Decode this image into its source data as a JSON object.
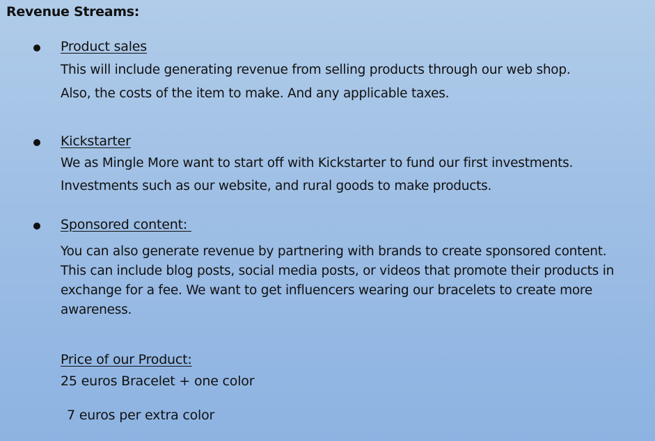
{
  "heading": "Revenue Streams:",
  "items": [
    {
      "title": "Product sales",
      "lines": [
        "This will include generating revenue from selling products through our web shop.",
        "Also, the costs of the item to make. And any applicable taxes."
      ]
    },
    {
      "title": "Kickstarter",
      "lines": [
        "We as Mingle More want to start off with Kickstarter to fund our first investments.",
        "Investments such as our website, and rural goods to make products."
      ]
    },
    {
      "title": "Sponsored content: ",
      "lines": [
        "You can also generate revenue by partnering with brands to create sponsored content.",
        "This can include blog posts, social media posts, or videos that promote their products in",
        "exchange for a fee. We want to get influencers wearing our bracelets to create more",
        "awareness."
      ]
    }
  ],
  "price": {
    "title": "Price of our Product:",
    "line1": "25 euros Bracelet + one color",
    "line2": "7 euros per extra color"
  }
}
